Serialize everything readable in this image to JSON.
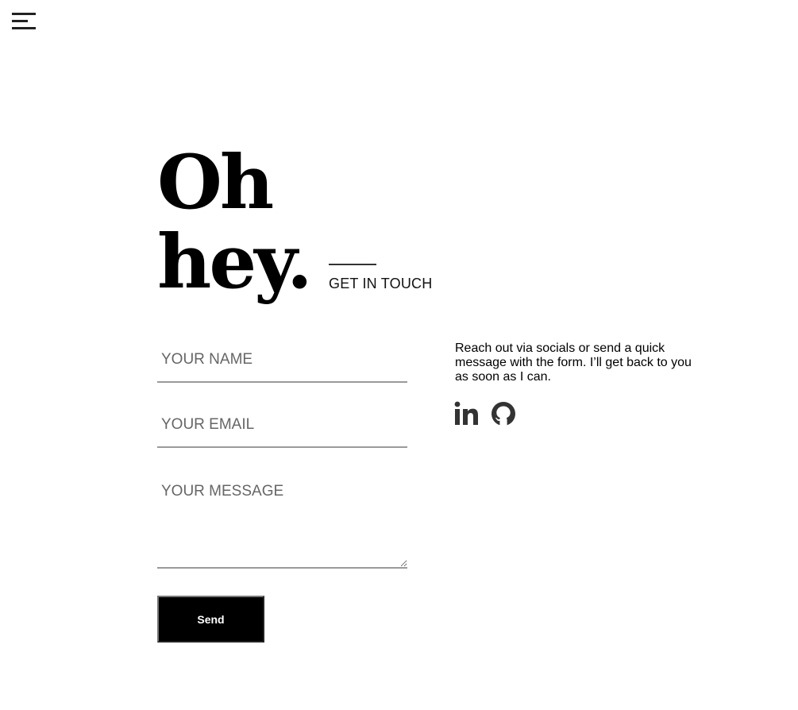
{
  "nav": {
    "menu_icon": "hamburger-menu-icon"
  },
  "hero": {
    "line1": "Oh",
    "line2": "hey.",
    "tagline": "GET IN TOUCH"
  },
  "form": {
    "name_placeholder": "YOUR NAME",
    "email_placeholder": "YOUR EMAIL",
    "message_placeholder": "YOUR MESSAGE",
    "submit_label": "Send"
  },
  "contact": {
    "intro": "Reach out via socials or send a quick message with the form. I’ll get back to you as soon as I can.",
    "socials": [
      {
        "name": "LinkedIn",
        "icon": "linkedin-icon"
      },
      {
        "name": "GitHub",
        "icon": "github-icon"
      }
    ]
  },
  "colors": {
    "background": "#ffffff",
    "text": "#000000",
    "button_bg": "#000000",
    "button_text": "#ffffff",
    "underline": "#9a9a9a",
    "icon": "#333333"
  }
}
